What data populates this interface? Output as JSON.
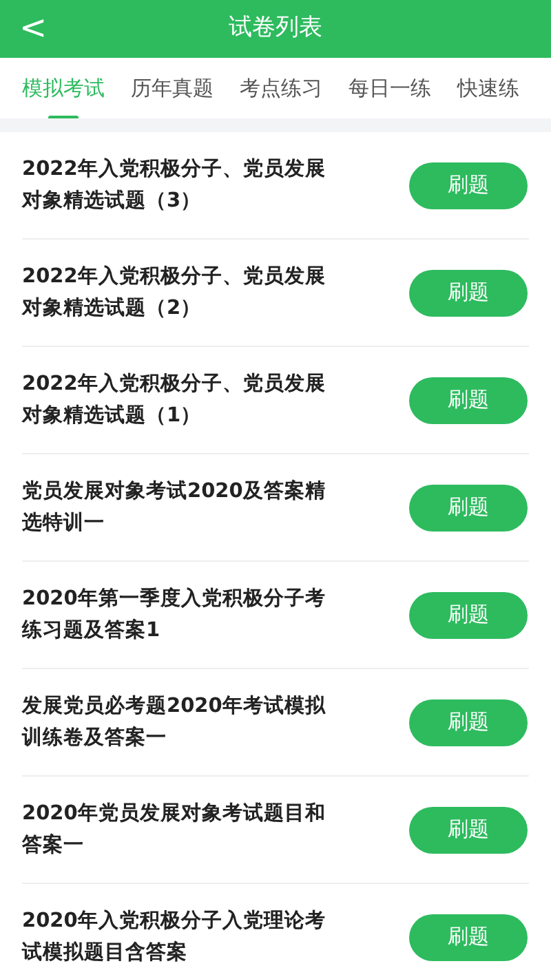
{
  "header": {
    "back": "<",
    "title": "试卷列表"
  },
  "tabs": [
    {
      "label": "模拟考试",
      "selected": true
    },
    {
      "label": "历年真题",
      "selected": false
    },
    {
      "label": "考点练习",
      "selected": false
    },
    {
      "label": "每日一练",
      "selected": false
    },
    {
      "label": "快速练",
      "selected": false
    }
  ],
  "papers": [
    {
      "title": "2022年入党积极分子、党员发展对象精选试题（3）",
      "button": "刷题"
    },
    {
      "title": "2022年入党积极分子、党员发展对象精选试题（2）",
      "button": "刷题"
    },
    {
      "title": "2022年入党积极分子、党员发展对象精选试题（1）",
      "button": "刷题"
    },
    {
      "title": "党员发展对象考试2020及答案精选特训一",
      "button": "刷题"
    },
    {
      "title": "2020年第一季度入党积极分子考练习题及答案1",
      "button": "刷题"
    },
    {
      "title": "发展党员必考题2020年考试模拟训练卷及答案一",
      "button": "刷题"
    },
    {
      "title": "2020年党员发展对象考试题目和答案一",
      "button": "刷题"
    },
    {
      "title": "2020年入党积极分子入党理论考试模拟题目含答案",
      "button": "刷题"
    }
  ]
}
